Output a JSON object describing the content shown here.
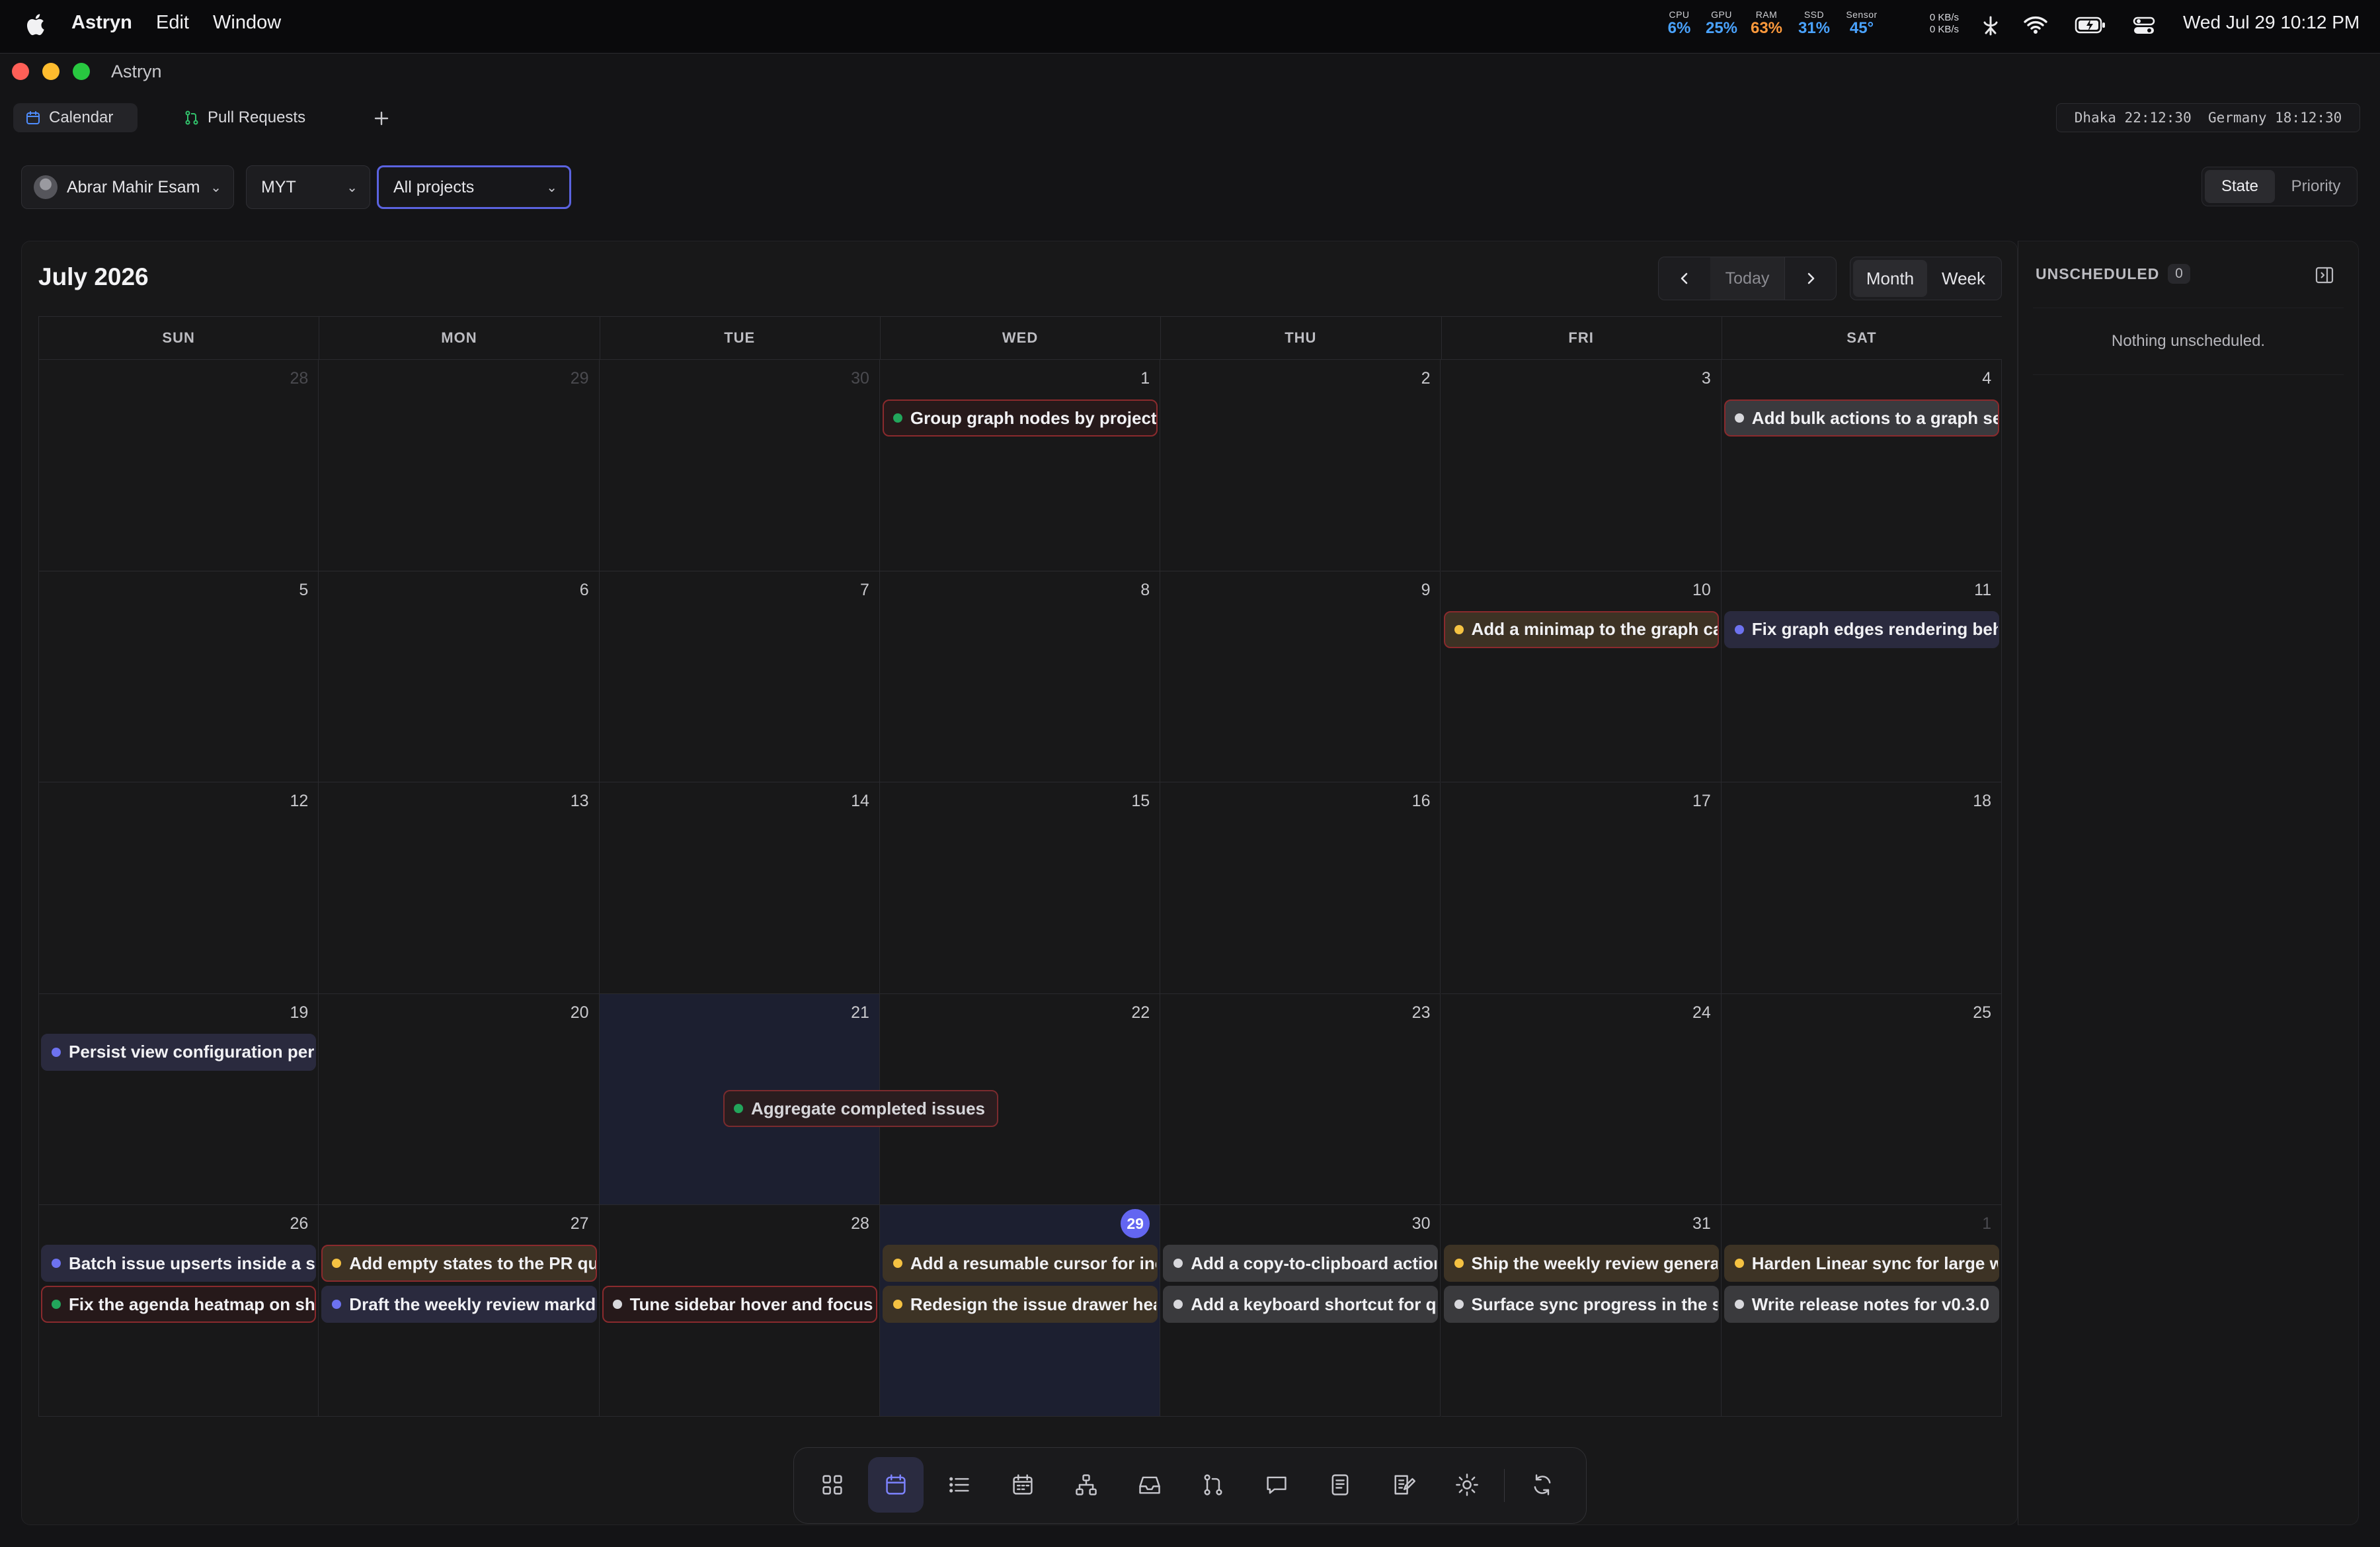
{
  "menubar": {
    "app_name": "Astryn",
    "menu_edit": "Edit",
    "menu_window": "Window",
    "stats": [
      {
        "label": "CPU",
        "value": "6%",
        "color": "#4aa3ff"
      },
      {
        "label": "GPU",
        "value": "25%",
        "color": "#4aa3ff"
      },
      {
        "label": "RAM",
        "value": "63%",
        "color": "#ff9a3c"
      },
      {
        "label": "SSD",
        "value": "31%",
        "color": "#4aa3ff"
      },
      {
        "label": "Sensor",
        "value": "45°",
        "color": "#4aa3ff"
      }
    ],
    "net_up": "0 KB/s",
    "net_down": "0 KB/s",
    "datetime": "Wed Jul 29  10:12 PM"
  },
  "window": {
    "title": "Astryn",
    "tabs": [
      {
        "label": "Calendar",
        "active": true
      },
      {
        "label": "Pull Requests",
        "active": false
      }
    ],
    "world_clock": "Dhaka 22:12:30  Germany 18:12:30"
  },
  "filters": {
    "user": "Abrar Mahir Esam",
    "timezone": "MYT",
    "project": "All projects",
    "group_state": "State",
    "group_priority": "Priority"
  },
  "calendar": {
    "title": "July 2026",
    "today_label": "Today",
    "view_month": "Month",
    "view_week": "Week",
    "weekdays": [
      "SUN",
      "MON",
      "TUE",
      "WED",
      "THU",
      "FRI",
      "SAT"
    ],
    "weeks": [
      [
        {
          "d": "28",
          "dim": true
        },
        {
          "d": "29",
          "dim": true
        },
        {
          "d": "30",
          "dim": true
        },
        {
          "d": "1"
        },
        {
          "d": "2"
        },
        {
          "d": "3"
        },
        {
          "d": "4"
        }
      ],
      [
        {
          "d": "5"
        },
        {
          "d": "6"
        },
        {
          "d": "7"
        },
        {
          "d": "8"
        },
        {
          "d": "9"
        },
        {
          "d": "10"
        },
        {
          "d": "11"
        }
      ],
      [
        {
          "d": "12"
        },
        {
          "d": "13"
        },
        {
          "d": "14"
        },
        {
          "d": "15"
        },
        {
          "d": "16"
        },
        {
          "d": "17"
        },
        {
          "d": "18"
        }
      ],
      [
        {
          "d": "19"
        },
        {
          "d": "20"
        },
        {
          "d": "21",
          "highlight": true
        },
        {
          "d": "22"
        },
        {
          "d": "23"
        },
        {
          "d": "24"
        },
        {
          "d": "25"
        }
      ],
      [
        {
          "d": "26"
        },
        {
          "d": "27"
        },
        {
          "d": "28"
        },
        {
          "d": "29",
          "today": true
        },
        {
          "d": "30"
        },
        {
          "d": "31"
        },
        {
          "d": "1",
          "dim": true
        }
      ]
    ],
    "events": [
      {
        "week": 0,
        "day": 3,
        "slot": 0,
        "title": "Group graph nodes by project",
        "dot": "#22a55b",
        "style": "red"
      },
      {
        "week": 0,
        "day": 6,
        "slot": 0,
        "title": "Add bulk actions to a graph selection",
        "dot": "#d8d8dc",
        "style": "red-gray"
      },
      {
        "week": 1,
        "day": 5,
        "slot": 0,
        "title": "Add a minimap to the graph canvas",
        "dot": "#f5c242",
        "style": "red-brown"
      },
      {
        "week": 1,
        "day": 6,
        "slot": 0,
        "title": "Fix graph edges rendering behind nodes",
        "dot": "#6d72f0",
        "style": "blue"
      },
      {
        "week": 3,
        "day": 0,
        "slot": 0,
        "title": "Persist view configuration per project",
        "dot": "#6d72f0",
        "style": "blue"
      },
      {
        "week": 4,
        "day": 0,
        "slot": 0,
        "title": "Batch issue upserts inside a sync",
        "dot": "#6d72f0",
        "style": "blue"
      },
      {
        "week": 4,
        "day": 0,
        "slot": 1,
        "title": "Fix the agenda heatmap on short weeks",
        "dot": "#22a55b",
        "style": "red"
      },
      {
        "week": 4,
        "day": 1,
        "slot": 0,
        "title": "Add empty states to the PR queue",
        "dot": "#f5c242",
        "style": "red-brown"
      },
      {
        "week": 4,
        "day": 1,
        "slot": 1,
        "title": "Draft the weekly review markdown",
        "dot": "#6d72f0",
        "style": "blue"
      },
      {
        "week": 4,
        "day": 2,
        "slot": 1,
        "title": "Tune sidebar hover and focus states",
        "dot": "#d8d8dc",
        "style": "red"
      },
      {
        "week": 4,
        "day": 3,
        "slot": 0,
        "title": "Add a resumable cursor for incremental sync",
        "dot": "#f5c242",
        "style": "brown"
      },
      {
        "week": 4,
        "day": 3,
        "slot": 1,
        "title": "Redesign the issue drawer header",
        "dot": "#f5c242",
        "style": "brown"
      },
      {
        "week": 4,
        "day": 4,
        "slot": 0,
        "title": "Add a copy-to-clipboard action",
        "dot": "#d8d8dc",
        "style": "gray"
      },
      {
        "week": 4,
        "day": 4,
        "slot": 1,
        "title": "Add a keyboard shortcut for quick capture",
        "dot": "#d8d8dc",
        "style": "gray"
      },
      {
        "week": 4,
        "day": 5,
        "slot": 0,
        "title": "Ship the weekly review generator",
        "dot": "#f5c242",
        "style": "brown"
      },
      {
        "week": 4,
        "day": 5,
        "slot": 1,
        "title": "Surface sync progress in the status bar",
        "dot": "#d8d8dc",
        "style": "gray"
      },
      {
        "week": 4,
        "day": 6,
        "slot": 0,
        "title": "Harden Linear sync for large workspaces",
        "dot": "#f5c242",
        "style": "brown"
      },
      {
        "week": 4,
        "day": 6,
        "slot": 1,
        "title": "Write release notes for v0.3.0",
        "dot": "#d8d8dc",
        "style": "gray"
      }
    ],
    "drag_event": {
      "title": "Aggregate completed issues",
      "dot": "#22a55b"
    }
  },
  "unscheduled": {
    "title": "UNSCHEDULED",
    "count": "0",
    "empty_text": "Nothing unscheduled."
  },
  "dock": {
    "icons": [
      "grid-icon",
      "calendar-icon",
      "list-icon",
      "agenda-icon",
      "graph-icon",
      "inbox-icon",
      "pull-request-icon",
      "chat-icon",
      "notes-icon",
      "review-icon",
      "settings-icon",
      "refresh-icon"
    ],
    "active": "calendar-icon"
  }
}
